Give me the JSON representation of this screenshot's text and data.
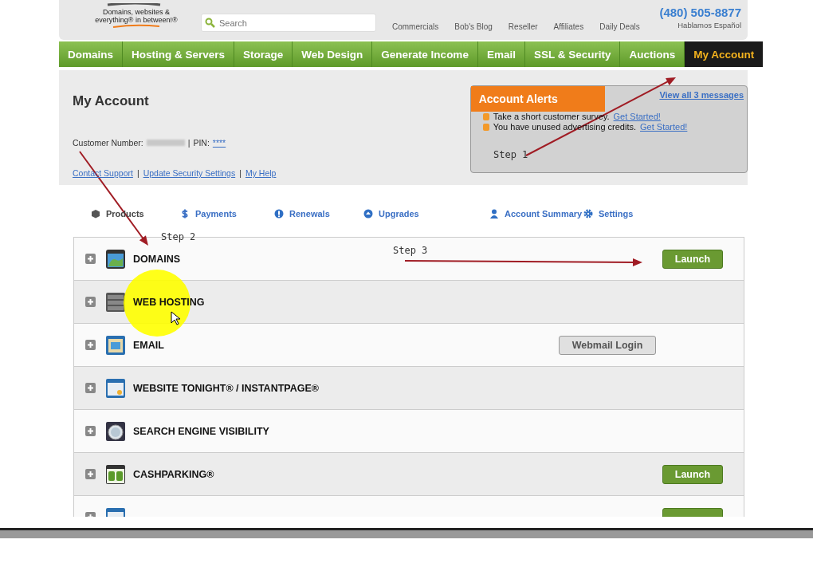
{
  "header": {
    "tagline": "Domains, websites & everything® in between!®",
    "search": {
      "placeholder": "Search"
    },
    "links": [
      "Commercials",
      "Bob's Blog",
      "Reseller",
      "Affiliates",
      "Daily Deals"
    ],
    "phone": "(480) 505-8877",
    "language": "Hablamos Español"
  },
  "nav": [
    {
      "label": "Domains",
      "selected": false
    },
    {
      "label": "Hosting & Servers",
      "selected": false
    },
    {
      "label": "Storage",
      "selected": false
    },
    {
      "label": "Web Design",
      "selected": false
    },
    {
      "label": "Generate Income",
      "selected": false
    },
    {
      "label": "Email",
      "selected": false
    },
    {
      "label": "SSL & Security",
      "selected": false
    },
    {
      "label": "Auctions",
      "selected": false
    },
    {
      "label": "My Account",
      "selected": true
    }
  ],
  "account": {
    "title": "My Account",
    "customer_label": "Customer Number:",
    "customer_separator": "|",
    "pin_label": "PIN:",
    "pin": "****",
    "links": [
      "Contact Support",
      "Update Security Settings",
      "My Help"
    ],
    "link_separators": [
      "|",
      "|"
    ]
  },
  "alerts": {
    "title": "Account Alerts",
    "view_all": "View all 3 messages",
    "items": [
      {
        "text": "Take a short customer survey.",
        "link": "Get Started!"
      },
      {
        "text": "You have unused advertising credits.",
        "link": "Get Started!"
      }
    ]
  },
  "tabs": [
    {
      "label": "Products",
      "kind": "box",
      "selected": true
    },
    {
      "label": "Payments",
      "kind": "dollar",
      "selected": false
    },
    {
      "label": "Renewals",
      "kind": "alert",
      "selected": false
    },
    {
      "label": "Upgrades",
      "kind": "up",
      "selected": false
    },
    {
      "label": "Account Summary",
      "kind": "person",
      "selected": false
    },
    {
      "label": "Settings",
      "kind": "gear",
      "selected": false
    }
  ],
  "products": [
    {
      "name": "DOMAINS",
      "kind": "globe",
      "expanded": false,
      "button": {
        "kind": "launch",
        "label": "Launch"
      }
    },
    {
      "name": "WEB HOSTING",
      "kind": "server",
      "expanded": false
    },
    {
      "name": "EMAIL",
      "kind": "mail",
      "expanded": false,
      "button": {
        "kind": "webmail",
        "label": "Webmail Login"
      }
    },
    {
      "name": "WEBSITE TONIGHT® / INSTANTPAGE®",
      "kind": "window",
      "expanded": false
    },
    {
      "name": "SEARCH ENGINE VISIBILITY",
      "kind": "lens",
      "expanded": false
    },
    {
      "name": "CASHPARKING®",
      "kind": "cash",
      "expanded": false,
      "button": {
        "kind": "launch",
        "label": "Launch"
      }
    },
    {
      "kind": "window",
      "expanded": false,
      "button": {
        "kind": "launch"
      }
    }
  ],
  "annotations": [
    {
      "label": "Step 1"
    },
    {
      "label": "Step 2"
    },
    {
      "label": "Step 3"
    }
  ]
}
